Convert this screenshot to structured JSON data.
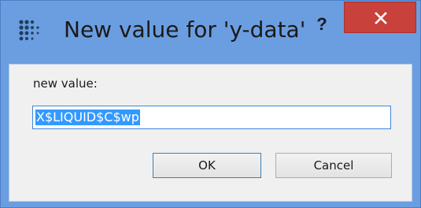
{
  "window": {
    "title": "New value for 'y-data'",
    "help_label": "?",
    "close_icon": "close-icon",
    "app_icon": "app-dots-icon"
  },
  "form": {
    "label": "new value:",
    "input_value": "X$LIQUID$C$wp",
    "input_selected": true
  },
  "buttons": {
    "ok_label": "OK",
    "cancel_label": "Cancel"
  },
  "colors": {
    "frame": "#6b9ee0",
    "close_button": "#c8413a",
    "selection": "#3399ff",
    "client": "#f0f0f0"
  }
}
